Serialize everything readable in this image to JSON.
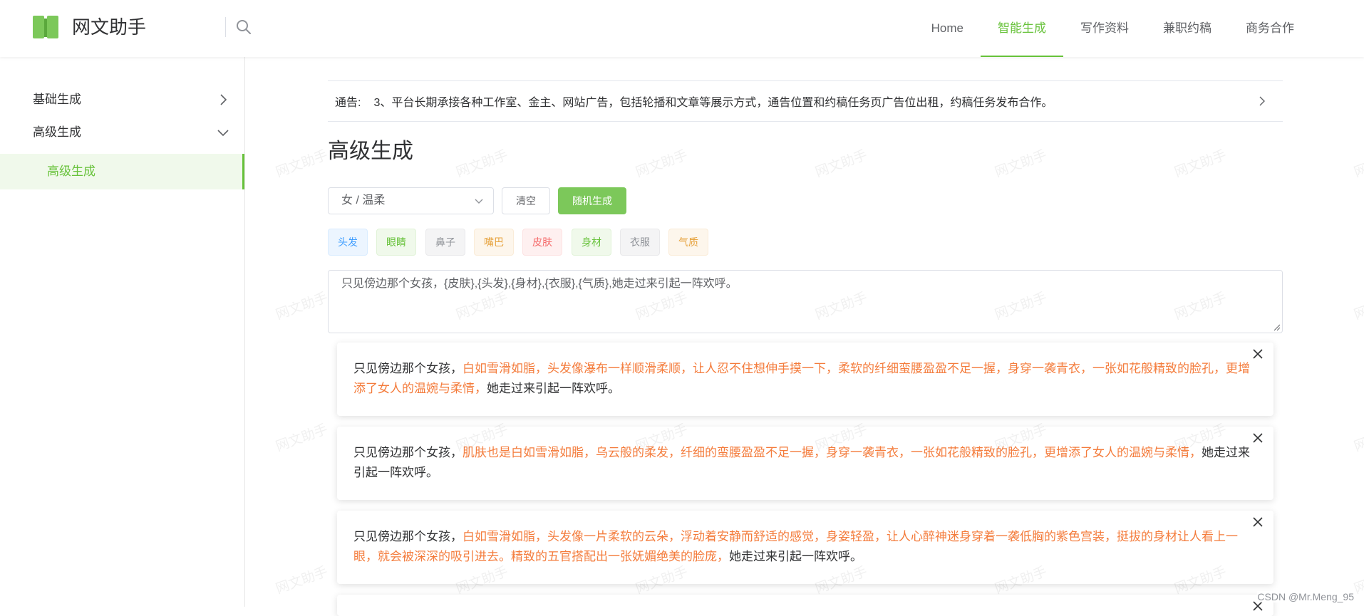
{
  "header": {
    "brand": "网文助手",
    "nav": [
      "Home",
      "智能生成",
      "写作资料",
      "兼职约稿",
      "商务合作"
    ],
    "active_nav": "智能生成"
  },
  "sidebar": {
    "items": [
      {
        "label": "基础生成",
        "expanded": false
      },
      {
        "label": "高级生成",
        "expanded": true
      }
    ],
    "active_sub": "高级生成"
  },
  "notice": {
    "label": "通告:",
    "text": "3、平台长期承接各种工作室、金主、网站广告，包括轮播和文章等展示方式，通告位置和约稿任务页广告位出租，约稿任务发布合作。"
  },
  "main": {
    "title": "高级生成",
    "select_value": "女 / 温柔",
    "clear_label": "清空",
    "random_label": "随机生成",
    "tags": [
      {
        "label": "头发",
        "color": "#409eff",
        "bg": "#ecf5ff",
        "border": "#d9ecff"
      },
      {
        "label": "眼睛",
        "color": "#67c23a",
        "bg": "#f0f9eb",
        "border": "#e1f3d8"
      },
      {
        "label": "鼻子",
        "color": "#909399",
        "bg": "#f4f4f5",
        "border": "#e9e9eb"
      },
      {
        "label": "嘴巴",
        "color": "#e6a23c",
        "bg": "#fdf6ec",
        "border": "#faecd8"
      },
      {
        "label": "皮肤",
        "color": "#f56c6c",
        "bg": "#fef0f0",
        "border": "#fde2e2"
      },
      {
        "label": "身材",
        "color": "#67c23a",
        "bg": "#f0f9eb",
        "border": "#e1f3d8"
      },
      {
        "label": "衣服",
        "color": "#909399",
        "bg": "#f4f4f5",
        "border": "#e9e9eb"
      },
      {
        "label": "气质",
        "color": "#e6a23c",
        "bg": "#fdf6ec",
        "border": "#faecd8"
      }
    ],
    "template": "只见傍边那个女孩，{皮肤},{头发},{身材},{衣服},{气质},她走过来引起一阵欢呼。"
  },
  "results": [
    {
      "prefix": "只见傍边那个女孩，",
      "highlight": "白如雪滑如脂，头发像瀑布一样顺滑柔顺，让人忍不住想伸手摸一下，柔软的纤细蛮腰盈盈不足一握，身穿一袭青衣，一张如花般精致的脸孔，更增添了女人的温婉与柔情，",
      "suffix": "她走过来引起一阵欢呼。"
    },
    {
      "prefix": "只见傍边那个女孩，",
      "highlight": "肌肤也是白如雪滑如脂，乌云般的柔发，纤细的蛮腰盈盈不足一握，身穿一袭青衣，一张如花般精致的脸孔，更增添了女人的温婉与柔情，",
      "suffix": "她走过来引起一阵欢呼。"
    },
    {
      "prefix": "只见傍边那个女孩，",
      "highlight": "白如雪滑如脂，头发像一片柔软的云朵，浮动着安静而舒适的感觉，身姿轻盈，让人心醉神迷身穿着一袭低胸的紫色宫装，挺拔的身材让人看上一眼，就会被深深的吸引进去。精致的五官搭配出一张妩媚绝美的脸庞，",
      "suffix": "她走过来引起一阵欢呼。"
    }
  ],
  "watermark": "网文助手",
  "credit": "CSDN @Mr.Meng_95",
  "colors": {
    "accent": "#67c23a",
    "highlight": "#f47c3c",
    "button": "#7cc85a"
  }
}
